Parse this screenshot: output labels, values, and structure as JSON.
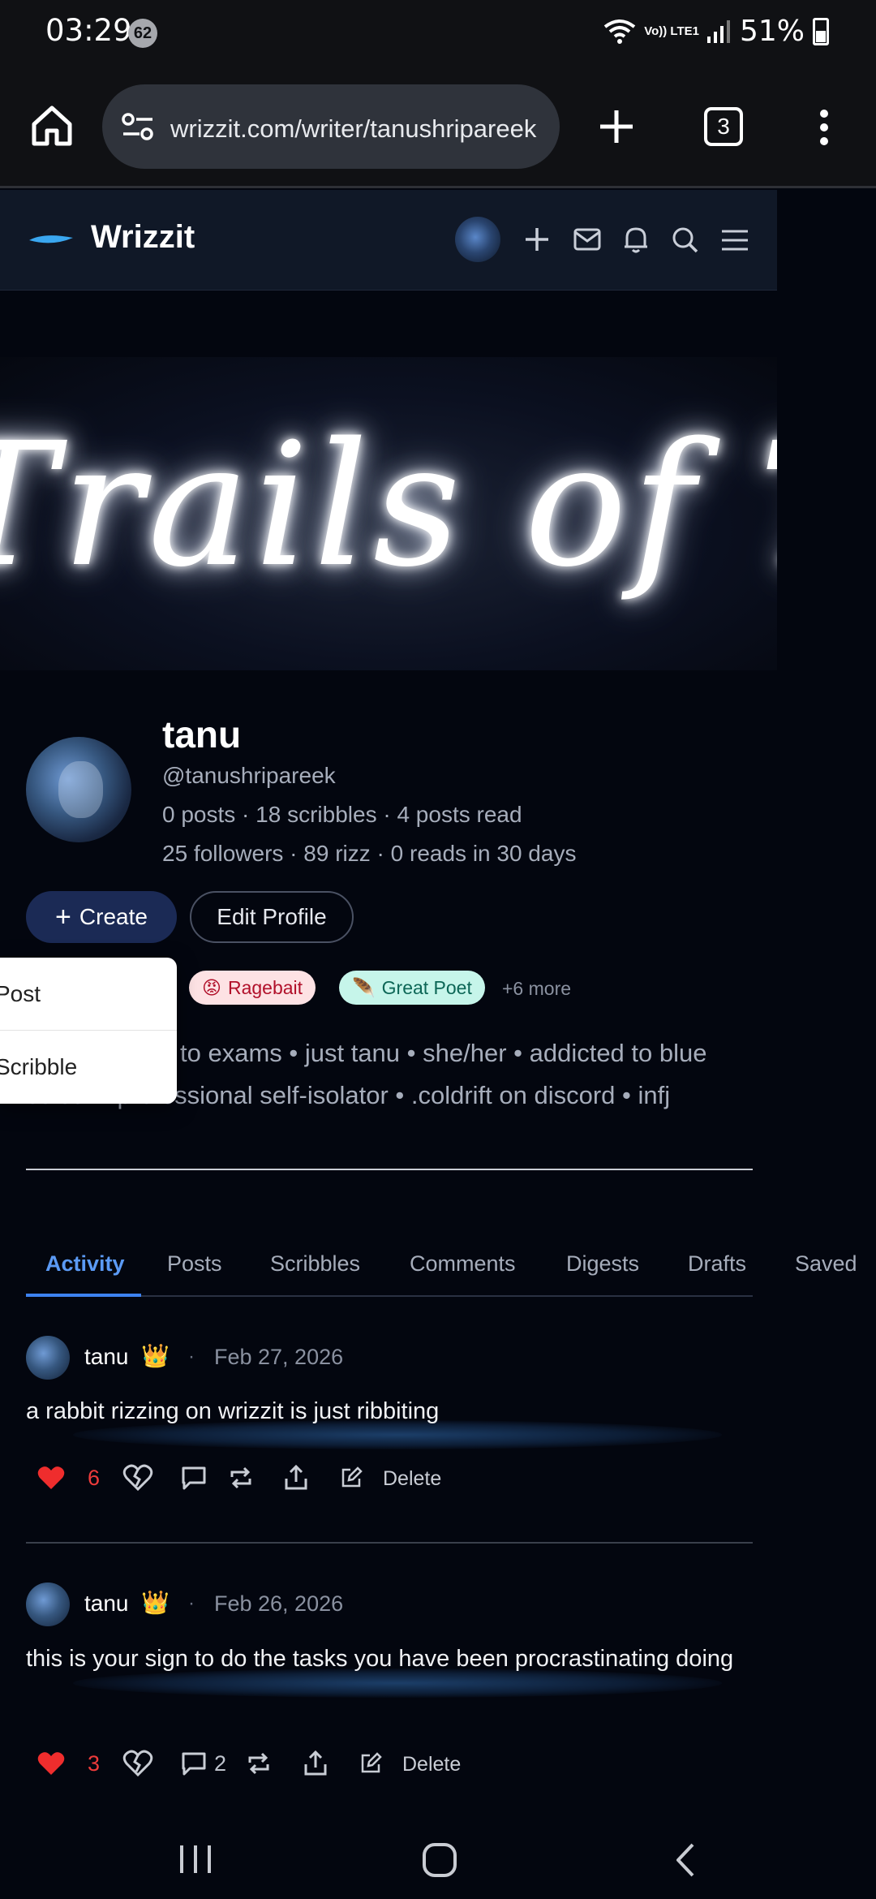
{
  "status_bar": {
    "time": "03:29",
    "notification_count": "62",
    "network": "Vo)) LTE1",
    "battery": "51%"
  },
  "browser": {
    "url": "wrizzit.com/writer/tanushripareek",
    "tab_count": "3"
  },
  "site": {
    "brand": "Wrizzit"
  },
  "banner": {
    "text": "Trails of Tanu"
  },
  "profile": {
    "name": "tanu",
    "handle": "@tanushripareek",
    "stats_line1": "0 posts · 18 scribbles · 4 posts read",
    "stats_line2": "25 followers · 89 rizz · 0 reads in 30 days",
    "create_label": "Create",
    "edit_label": "Edit Profile",
    "badges": [
      {
        "emoji": "😡",
        "label": "Ragebait"
      },
      {
        "emoji": "🪶",
        "label": "Great Poet"
      }
    ],
    "badges_more": "+6 more",
    "bio_line1": "to exams • just tanu • she/her • addicted to blue",
    "bio_line2": "colour • professional self-isolator • .coldrift on discord • infj"
  },
  "create_menu": {
    "items": [
      "Post",
      "Scribble"
    ]
  },
  "tabs": [
    "Activity",
    "Posts",
    "Scribbles",
    "Comments",
    "Digests",
    "Drafts",
    "Saved"
  ],
  "active_tab": "Activity",
  "posts": [
    {
      "user": "tanu",
      "crown": "👑",
      "date": "Feb 27, 2026",
      "body": "a rabbit rizzing on wrizzit is just ribbiting",
      "likes": "6",
      "comments": "",
      "delete_label": "Delete"
    },
    {
      "user": "tanu",
      "crown": "👑",
      "date": "Feb 26, 2026",
      "body": "this is your sign to do the tasks you have been procrastinating doing",
      "likes": "3",
      "comments": "2",
      "delete_label": "Delete"
    }
  ],
  "colors": {
    "accent": "#3d82f0",
    "like": "#ef3b3b",
    "background": "#03060f"
  }
}
